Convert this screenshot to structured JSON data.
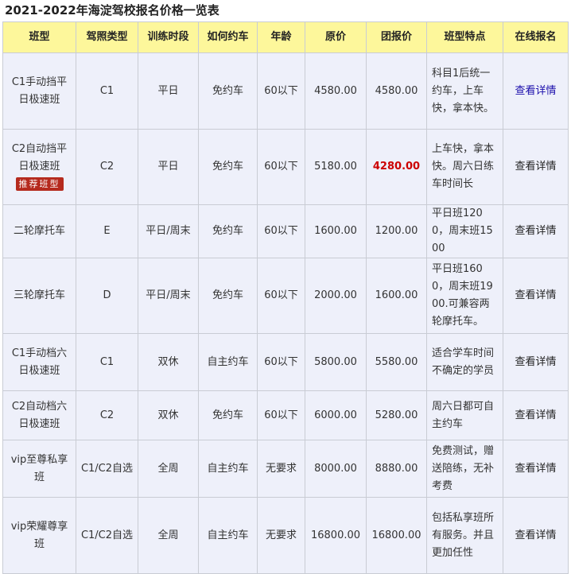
{
  "title": "2021-2022年海淀驾校报名价格一览表",
  "table": {
    "headers": [
      "班型",
      "驾照类型",
      "训练时段",
      "如何约车",
      "年龄",
      "原价",
      "团报价",
      "班型特点",
      "在线报名"
    ],
    "rows": [
      {
        "name": "C1手动挡平日极速班",
        "license": "C1",
        "period": "平日",
        "booking": "免约车",
        "age": "60以下",
        "orig": "4580.00",
        "group": "4580.00",
        "feature": "科目1后统一约车，上车快，拿本快。",
        "link": "查看详情"
      },
      {
        "name": "C2自动挡平日极速班",
        "badge": "推荐班型",
        "license": "C2",
        "period": "平日",
        "booking": "免约车",
        "age": "60以下",
        "orig": "5180.00",
        "group": "4280.00",
        "feature": "上车快，拿本快。周六日练车时间长",
        "link": "查看详情"
      },
      {
        "name": "二轮摩托车",
        "license": "E",
        "period": "平日/周末",
        "booking": "免约车",
        "age": "60以下",
        "orig": "1600.00",
        "group": "1200.00",
        "feature": "平日班1200，周末班1500",
        "link": "查看详情"
      },
      {
        "name": "三轮摩托车",
        "license": "D",
        "period": "平日/周末",
        "booking": "免约车",
        "age": "60以下",
        "orig": "2000.00",
        "group": "1600.00",
        "feature": "平日班1600，周末班1900.可兼容两轮摩托车。",
        "link": "查看详情"
      },
      {
        "name": "C1手动档六日极速班",
        "license": "C1",
        "period": "双休",
        "booking": "自主约车",
        "age": "60以下",
        "orig": "5800.00",
        "group": "5580.00",
        "feature": "适合学车时间不确定的学员",
        "link": "查看详情"
      },
      {
        "name": "C2自动档六日极速班",
        "license": "C2",
        "period": "双休",
        "booking": "免约车",
        "age": "60以下",
        "orig": "6000.00",
        "group": "5280.00",
        "feature": "周六日都可自主约车",
        "link": "查看详情"
      },
      {
        "name": "vip至尊私享班",
        "license": "C1/C2自选",
        "period": "全周",
        "booking": "自主约车",
        "age": "无要求",
        "orig": "8000.00",
        "group": "8880.00",
        "feature": "免费测试，赠送陪练，无补考费",
        "link": "查看详情"
      },
      {
        "name": "vip荣耀尊享班",
        "license": "C1/C2自选",
        "period": "全周",
        "booking": "自主约车",
        "age": "无要求",
        "orig": "16800.00",
        "group": "16800.00",
        "feature": "包括私享班所有服务。并且更加任性",
        "link": "查看详情"
      }
    ]
  },
  "colors": {
    "header_bg": "#fdf79b",
    "cell_bg": "#eef0fa",
    "border": "#c9ccd4",
    "hot_price": "#cc0000",
    "badge_bg": "#b52a1e",
    "link_blue": "#1a0dab"
  }
}
